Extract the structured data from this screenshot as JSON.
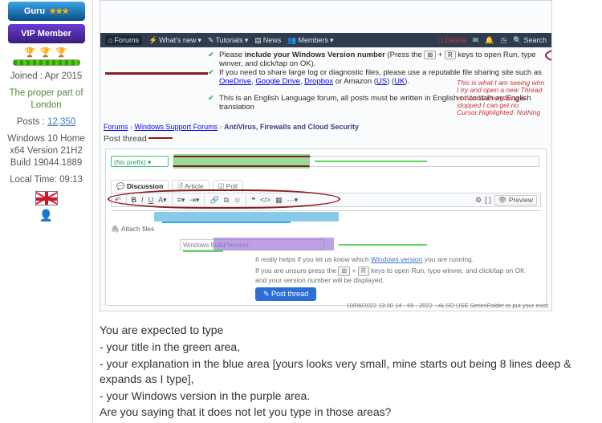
{
  "sidebar": {
    "guru_label": "Guru",
    "vip_label": "VIP Member",
    "joined_label": "Joined :",
    "joined_value": "Apr 2015",
    "user_title": "The proper part of London",
    "posts_label": "Posts :",
    "posts_value": "12,350",
    "os_line1": "Windows 10 Home x64 Version 21H2 Build 19044.1889",
    "local_time_label": "Local Time:",
    "local_time_value": "09:13"
  },
  "topbar": {
    "forums": "Forums",
    "whatsnew": "What's new",
    "tutorials": "Tutorials",
    "news": "News",
    "members": "Members",
    "user": "Dasha",
    "search": "Search"
  },
  "rules": {
    "r1_pre": "Please ",
    "r1_bold": "include your Windows Version number",
    "r1_post1": " (Press the ",
    "r1_key1": "⊞",
    "r1_plus": " + ",
    "r1_key2": "R",
    "r1_post2": " keys to open Run, type winver, and click/tap on OK).",
    "r2_main": "If you need to share large log or diagnostic files, please use a reputable file sharing site such as ",
    "r2_l1": "OneDrive",
    "r2_c": ", ",
    "r2_l2": "Google Drive",
    "r2_l3": "Dropbox",
    "r2_tail": " or Amazon (",
    "r2_l4": "US",
    "r2_tailP": ") (",
    "r2_l5": "UK",
    "r2_tailE": ").",
    "r3": "This is an English Language forum, all posts must be written in English or contain an English translation"
  },
  "side_note": "This is what I am seeing whn I try and open a new Thread in Win 11 Everything is stopped I can get no Cursor.Highlighted. Nothing",
  "crumbs": {
    "a": "Forums",
    "b": "Windows Support Forums",
    "c": "AntiVirus, Firewalls and Cloud Security"
  },
  "post_thread": "Post thread",
  "editor": {
    "prefix": "(No prefix)",
    "tabs": {
      "disc": "Discussion",
      "art": "Article",
      "poll": "Poll"
    },
    "preview": "Preview",
    "attach": "Attach files",
    "buildver_ph": "Windows Build/Version:",
    "hint1_a": "It really helps if you let us know which ",
    "hint1_link": "Windows version",
    "hint1_b": " you are running.",
    "hint2_a": "If you are unsure press the ",
    "hint2_k1": "⊞",
    "hint2_plus": " + ",
    "hint2_k2": "R",
    "hint2_b": " keys to open Run, type winver, and click/tap on OK and your version number will be displayed.",
    "post_btn": "Post thread"
  },
  "foot": "10/06/2022 13:00   14 - 69 - 2022 --ALSO USE  SeriesFolder  to  put your exist",
  "body": {
    "l1": "You are expected to type",
    "l2": "- your title in the green area,",
    "l3": "- your explanation in the blue area [yours looks very small, mine starts out being 8 lines deep & expands as I type],",
    "l4": "- your Windows version in the purple area.",
    "l5": "Are you saying that it does not let you type in those areas?"
  }
}
